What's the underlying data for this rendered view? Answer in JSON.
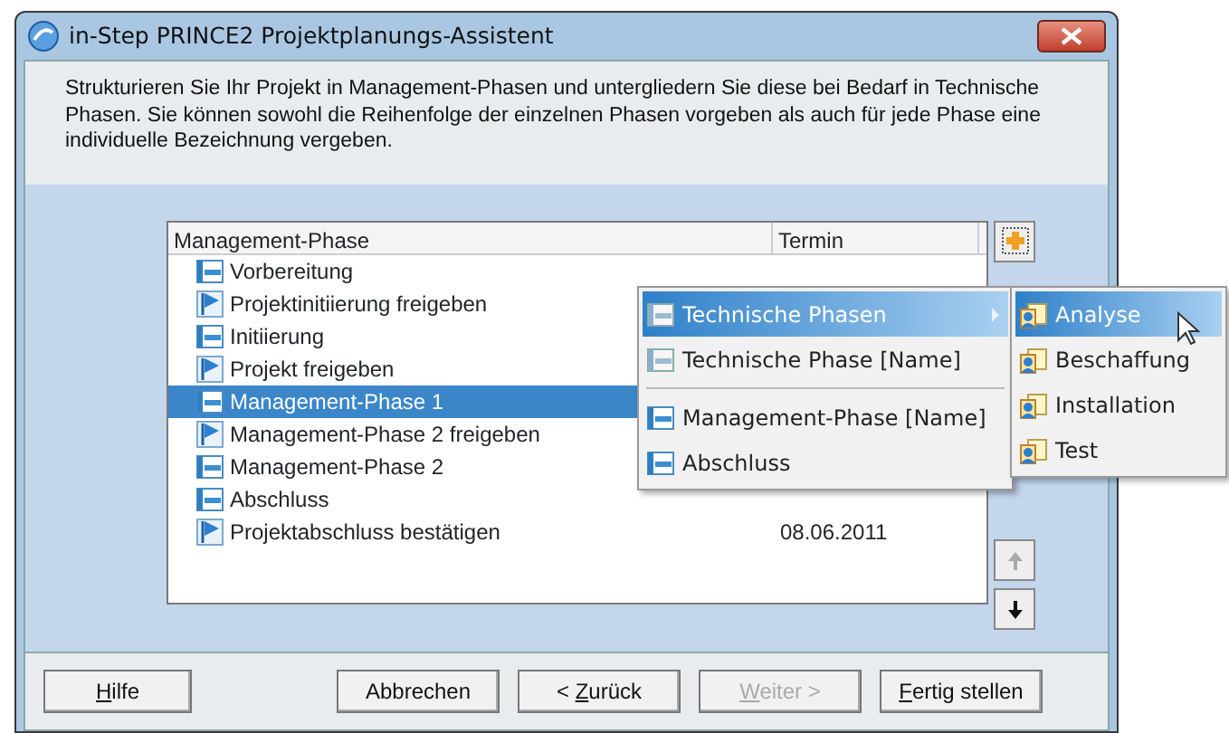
{
  "window": {
    "title": "in-Step PRINCE2 Projektplanungs-Assistent"
  },
  "description": "Strukturieren Sie Ihr Projekt in Management-Phasen und untergliedern Sie diese bei Bedarf in Technische Phasen. Sie können sowohl die Reihenfolge der einzelnen Phasen vorgeben als auch für jede Phase eine individuelle Bezeichnung vergeben.",
  "table": {
    "columns": [
      "Management-Phase",
      "Termin"
    ],
    "rows": [
      {
        "kind": "phase",
        "name": "Vorbereitung",
        "selected": false
      },
      {
        "kind": "milestone",
        "name": "Projektinitiierung freigeben",
        "selected": false
      },
      {
        "kind": "phase",
        "name": "Initiierung",
        "selected": false
      },
      {
        "kind": "milestone",
        "name": "Projekt freigeben",
        "selected": false
      },
      {
        "kind": "phase",
        "name": "Management-Phase 1",
        "selected": true
      },
      {
        "kind": "milestone",
        "name": "Management-Phase 2 freigeben",
        "selected": false
      },
      {
        "kind": "phase",
        "name": "Management-Phase 2",
        "selected": false
      },
      {
        "kind": "phase",
        "name": "Abschluss",
        "selected": false
      },
      {
        "kind": "milestone",
        "name": "Projektabschluss bestätigen",
        "selected": false,
        "termin": "08.06.2011"
      }
    ]
  },
  "side_buttons": {
    "up_disabled": true,
    "down_disabled": false
  },
  "context_menu": [
    {
      "kind": "technical",
      "label": "Technische Phasen",
      "selected": true,
      "submenu": true
    },
    {
      "kind": "technical",
      "label": "Technische Phase [Name]",
      "selected": false,
      "submenu": false
    },
    {
      "kind": "separator"
    },
    {
      "kind": "management",
      "label": "Management-Phase [Name]",
      "selected": false,
      "submenu": false
    },
    {
      "kind": "management",
      "label": "Abschluss",
      "selected": false,
      "submenu": false
    }
  ],
  "submenu": [
    {
      "label": "Analyse",
      "selected": true
    },
    {
      "label": "Beschaffung",
      "selected": false
    },
    {
      "label": "Installation",
      "selected": false
    },
    {
      "label": "Test",
      "selected": false
    }
  ],
  "buttons": [
    {
      "label": [
        {
          "text": "H",
          "underlined": true
        },
        {
          "text": "ilfe",
          "underlined": false
        }
      ],
      "disabled": false
    },
    {
      "label": [
        {
          "text": "Abbrechen",
          "underlined": false
        }
      ],
      "disabled": false
    },
    {
      "label": [
        {
          "text": "< ",
          "underlined": false
        },
        {
          "text": "Z",
          "underlined": true
        },
        {
          "text": "urück",
          "underlined": false
        }
      ],
      "disabled": false
    },
    {
      "label": [
        {
          "text": "W",
          "underlined": true
        },
        {
          "text": "eiter >",
          "underlined": false
        }
      ],
      "disabled": true
    },
    {
      "label": [
        {
          "text": "F",
          "underlined": true
        },
        {
          "text": "ertig stellen",
          "underlined": false
        }
      ],
      "disabled": false
    }
  ]
}
